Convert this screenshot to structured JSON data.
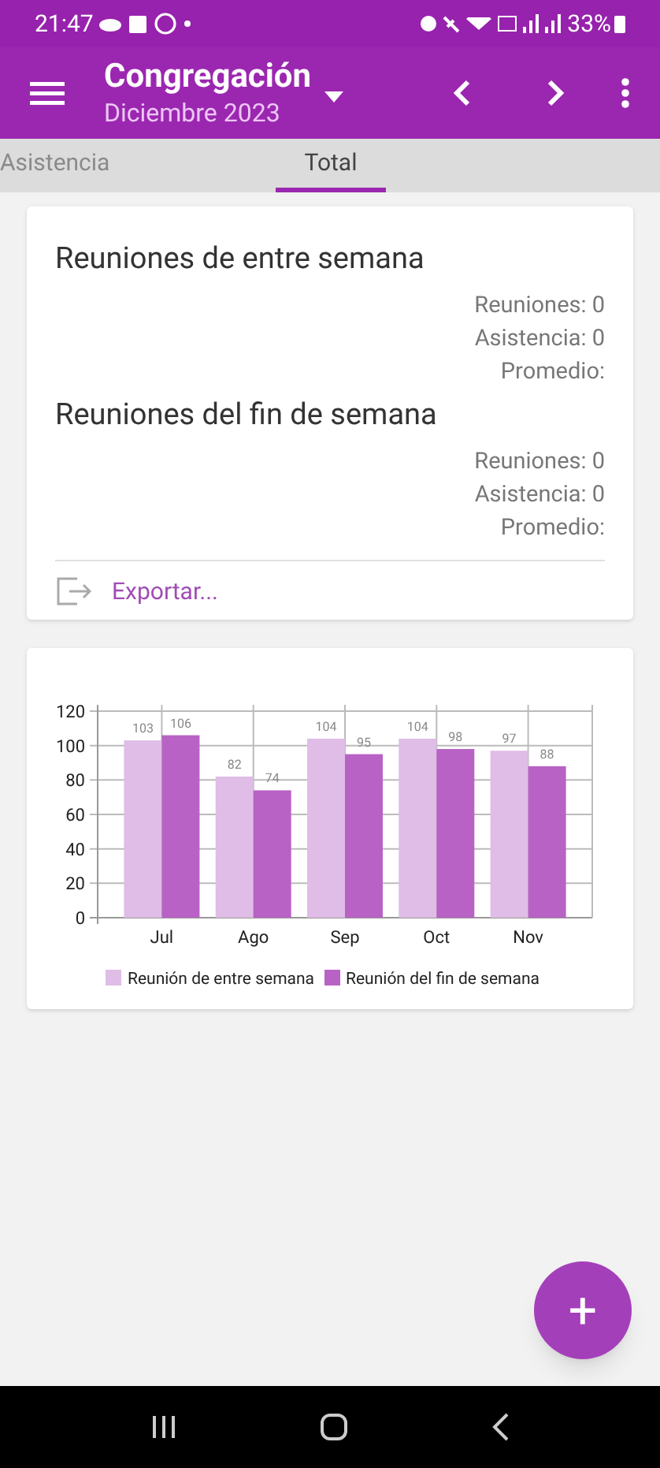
{
  "status_bar": {
    "time": "21:47",
    "battery": "33%"
  },
  "app_bar": {
    "title": "Congregación",
    "subtitle": "Diciembre 2023"
  },
  "tabs": [
    {
      "label": "Asistencia",
      "selected": false
    },
    {
      "label": "Total",
      "selected": true
    }
  ],
  "summary": {
    "sections": [
      {
        "title": "Reuniones de entre semana",
        "stats": [
          "Reuniones: 0",
          "Asistencia: 0",
          "Promedio:"
        ]
      },
      {
        "title": "Reuniones del fin de semana",
        "stats": [
          "Reuniones: 0",
          "Asistencia: 0",
          "Promedio:"
        ]
      }
    ],
    "export_label": "Exportar..."
  },
  "chart_card": {
    "chart_data": {
      "type": "bar",
      "categories": [
        "Jul",
        "Ago",
        "Sep",
        "Oct",
        "Nov"
      ],
      "yticks": [
        0,
        20,
        40,
        60,
        80,
        100,
        120
      ],
      "ylim": [
        0,
        120
      ],
      "data_labels": true,
      "grid": true,
      "series": [
        {
          "name": "Reunión de entre semana",
          "color": "#dfbde6",
          "values": [
            103,
            82,
            104,
            104,
            97
          ]
        },
        {
          "name": "Reunión del fin de semana",
          "color": "#b862c5",
          "values": [
            106,
            74,
            95,
            98,
            88
          ]
        }
      ]
    }
  },
  "fab": {
    "label": "+"
  }
}
